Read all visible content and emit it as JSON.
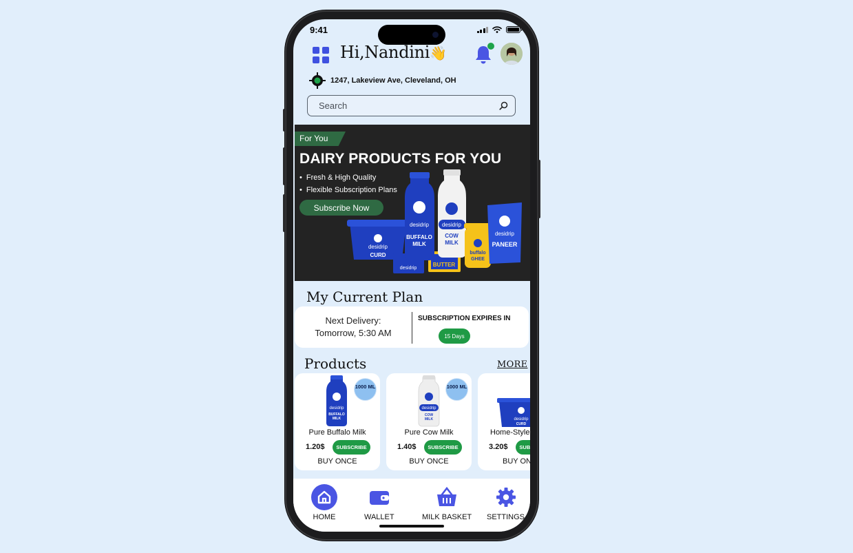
{
  "status_bar": {
    "time": "9:41"
  },
  "header": {
    "greeting": "Hi,Nandini",
    "wave_emoji": "👋",
    "address": "1247, Lakeview Ave, Cleveland, OH"
  },
  "search": {
    "placeholder": "Search"
  },
  "banner": {
    "tag": "For You",
    "title": "DAIRY PRODUCTS FOR YOU",
    "bullets": [
      "Fresh & High Quality",
      "Flexible Subscription Plans"
    ],
    "cta": "Subscribe Now",
    "brand": "desidrip",
    "product_labels": [
      "CURD",
      "BUTTER",
      "BUFFALO MILK",
      "COW MILK",
      "buffalo GHEE",
      "PANEER"
    ]
  },
  "current_plan": {
    "title": "My Current Plan",
    "next_delivery_label": "Next Delivery:",
    "next_delivery_value": "Tomorrow, 5:30 AM",
    "expires_label": "SUBSCRIPTION EXPIRES IN",
    "expires_value": "15 Days"
  },
  "products": {
    "title": "Products",
    "more_label": "MORE",
    "items": [
      {
        "name": "Pure Buffalo Milk",
        "price": "1.20$",
        "badge": "1000 ML",
        "subscribe": "SUBSCRIBE",
        "buy_once": "BUY ONCE",
        "label": "BUFFALO MILK"
      },
      {
        "name": "Pure Cow Milk",
        "price": "1.40$",
        "badge": "1000 ML",
        "subscribe": "SUBSCRIBE",
        "buy_once": "BUY ONCE",
        "label": "COW MILK"
      },
      {
        "name": "Home-Style Curd",
        "price": "3.20$",
        "subscribe": "SUBSCRIBE",
        "buy_once": "BUY ONCE",
        "label": "CURD"
      }
    ]
  },
  "bottom_nav": {
    "items": [
      "HOME",
      "WALLET",
      "MILK BASKET",
      "SETTINGS"
    ],
    "active": "HOME"
  },
  "colors": {
    "accent": "#4a55e3",
    "green": "#1f9a45",
    "banner_green": "#2f6a43",
    "background": "#e1eefb"
  }
}
